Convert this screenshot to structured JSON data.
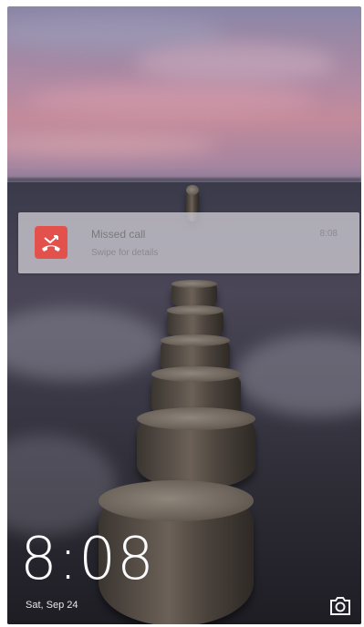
{
  "lockscreen": {
    "time": "8:08",
    "date": "Sat, Sep 24"
  },
  "notification": {
    "icon": "missed-call-icon",
    "title": "Missed call",
    "subtitle": "Swipe for details",
    "time": "8:08",
    "accent_color": "#e2514b"
  },
  "shortcuts": {
    "camera_icon": "camera-icon"
  }
}
